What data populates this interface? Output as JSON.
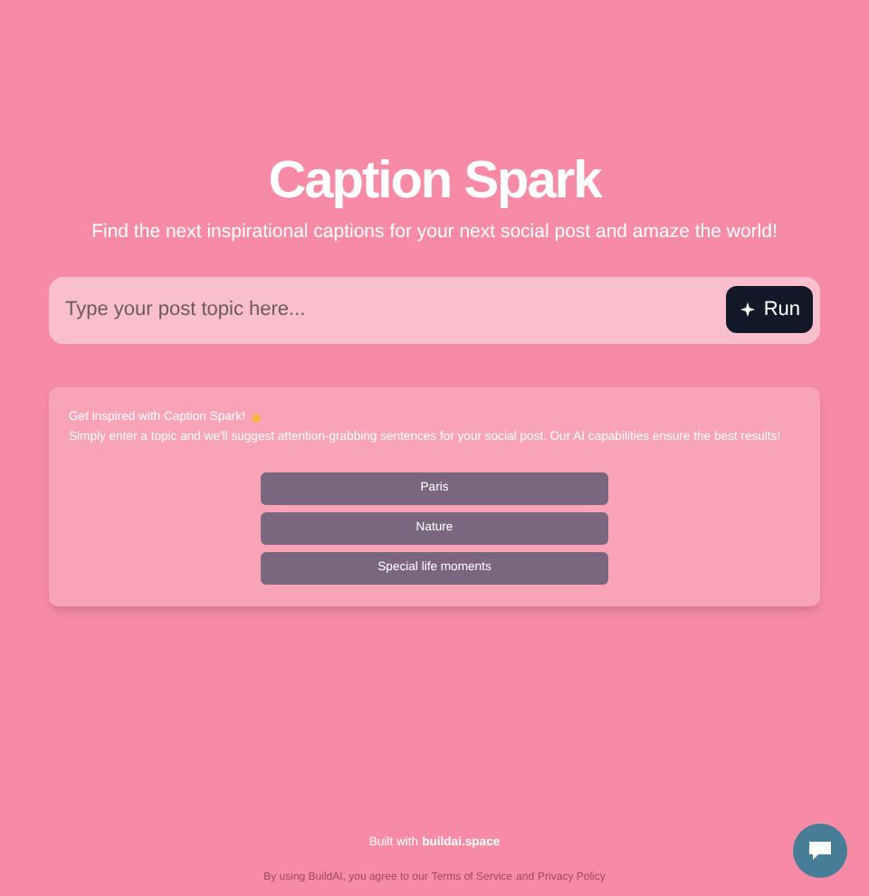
{
  "header": {
    "title": "Caption Spark",
    "subtitle": "Find the next inspirational captions for your next social post and amaze the world!"
  },
  "search": {
    "placeholder": "Type your post topic here...",
    "button": "Run"
  },
  "card": {
    "heading": "Get inspired with Caption Spark!",
    "text": "Simply enter a topic and we'll suggest attention-grabbing sentences for your social post. Our AI capabilities ensure the best results!",
    "suggestions": [
      "Paris",
      "Nature",
      "Special life moments"
    ]
  },
  "footer": {
    "built_with": "Built with",
    "brand": "buildai.space",
    "consent": "By using BuildAI, you agree to our",
    "terms": "Terms of Service",
    "and": "and",
    "privacy": "Privacy Policy"
  }
}
